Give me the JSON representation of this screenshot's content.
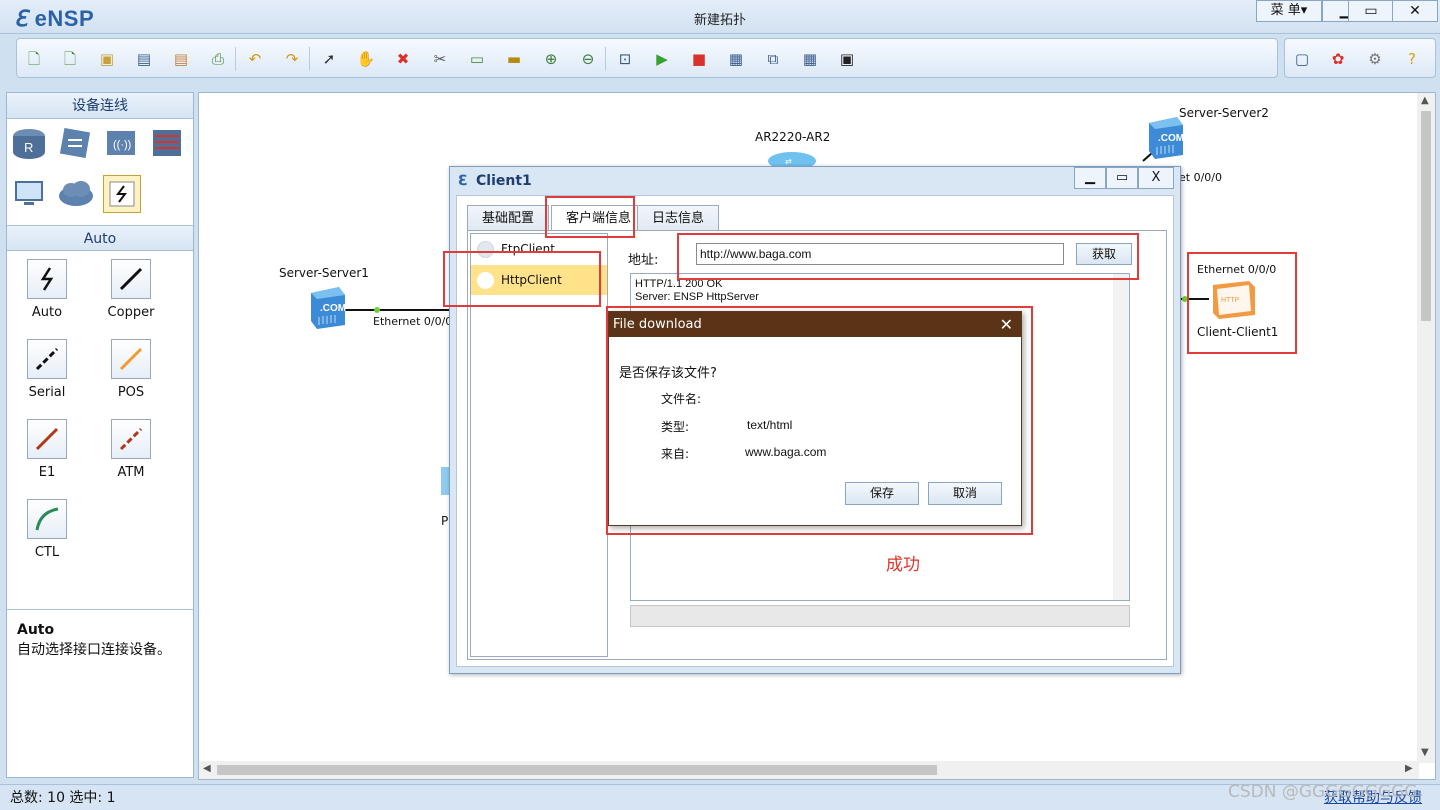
{
  "app": {
    "logo": "eNSP",
    "title": "新建拓扑",
    "menu_label": "菜 单▾"
  },
  "toolbar": {
    "left_icons": [
      "new-topo-icon",
      "new-lab-icon",
      "open-icon",
      "save-icon",
      "save-as-icon",
      "print-icon",
      "undo-icon",
      "redo-icon",
      "select-icon",
      "pan-icon",
      "delete-icon",
      "delete-link-icon",
      "text-icon",
      "rectangle-icon",
      "zoom-in-icon",
      "zoom-out-icon",
      "fit-icon",
      "start-icon",
      "stop-icon",
      "capture-icon",
      "topology-icon",
      "grid-icon",
      "cli-icon"
    ],
    "right_icons": [
      "chat-icon",
      "huawei-icon",
      "settings-icon",
      "help-icon"
    ]
  },
  "leftpanel": {
    "header": "设备连线",
    "auto_header": "Auto",
    "cables": [
      "Auto",
      "Copper",
      "Serial",
      "POS",
      "E1",
      "ATM",
      "CTL"
    ],
    "desc_title": "Auto",
    "desc_text": "自动选择接口连接设备。"
  },
  "canvas": {
    "nodes": {
      "server1": "Server-Server1",
      "server2": "Server-Server2",
      "router": "AR2220-AR2",
      "client": "Client-Client1",
      "partial": "P"
    },
    "ports": {
      "server1_port": "Ethernet 0/0/0",
      "server2_port": "et 0/0/0",
      "client_port": "Ethernet 0/0/0"
    }
  },
  "client_window": {
    "title": "Client1",
    "tabs": [
      "基础配置",
      "客户端信息",
      "日志信息"
    ],
    "list": [
      "FtpClient",
      "HttpClient"
    ],
    "addr_label": "地址:",
    "addr_value": "http://www.baga.com",
    "fetch_label": "获取",
    "response_lines": [
      "HTTP/1.1 200 OK",
      "Server: ENSP HttpServer"
    ]
  },
  "file_download": {
    "title": "File download",
    "question": "是否保存该文件?",
    "filename_label": "文件名:",
    "type_label": "类型:",
    "type_value": "text/html",
    "from_label": "来自:",
    "from_value": "www.baga.com",
    "save_label": "保存",
    "cancel_label": "取消"
  },
  "annotation": {
    "success": "成功"
  },
  "status": {
    "text": "总数: 10 选中: 1",
    "help": "获取帮助与反馈"
  },
  "watermark": "CSDN @GGGGGGGGG"
}
